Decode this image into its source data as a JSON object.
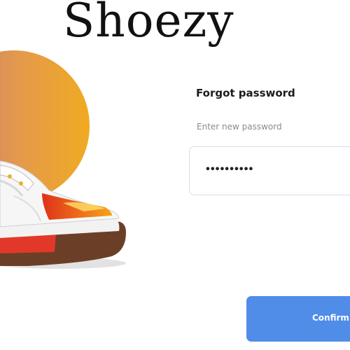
{
  "brand": {
    "name": "Shoezy"
  },
  "hero": {
    "icon": "sneaker-illustration",
    "gradient_colors": [
      "#c07c78",
      "#e59a4a",
      "#f0aa22"
    ]
  },
  "form": {
    "title": "Forgot password",
    "field_label": "Enter new password",
    "password_value": "••••••••••",
    "confirm_label": "Confirm"
  },
  "colors": {
    "accent": "#4f8de9",
    "text": "#1c1c1c",
    "muted": "#8a8a8a"
  }
}
